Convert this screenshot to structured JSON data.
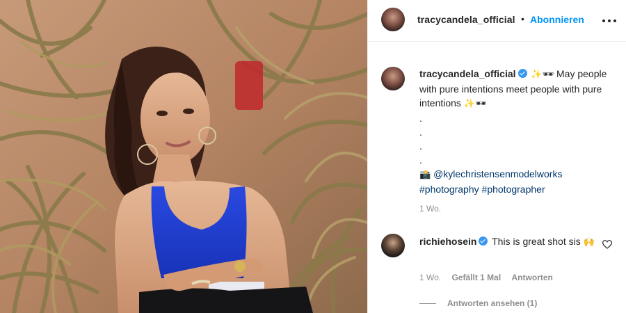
{
  "header": {
    "username": "tracycandela_official",
    "separator": "•",
    "follow_label": "Abonnieren",
    "more_icon": "more-horizontal-icon"
  },
  "post": {
    "image_alt_icon": "photo-image",
    "caption": {
      "username": "tracycandela_official",
      "emoji_a": "✨🕶",
      "text_1": "May people with pure intentions meet people with pure intentions",
      "emoji_b": "✨🕶",
      "dots": [
        ".",
        ".",
        ".",
        "."
      ],
      "camera_emoji": "📸",
      "mention": "@kylechristensenmodelworks",
      "hashtag_1": "#photography",
      "hashtag_2": "#photographer",
      "time": "1 Wo."
    },
    "comment": {
      "username": "richiehosein",
      "text": "This is great shot sis",
      "emoji": "🙌",
      "time": "1 Wo.",
      "likes": "Gefällt 1 Mal",
      "reply_label": "Antworten",
      "view_replies": "Antworten ansehen (1)"
    }
  },
  "colors": {
    "accent": "#0095f6",
    "link": "#00376b",
    "verified": "#3897f0",
    "muted": "#8e8e8e",
    "text": "#262626"
  }
}
